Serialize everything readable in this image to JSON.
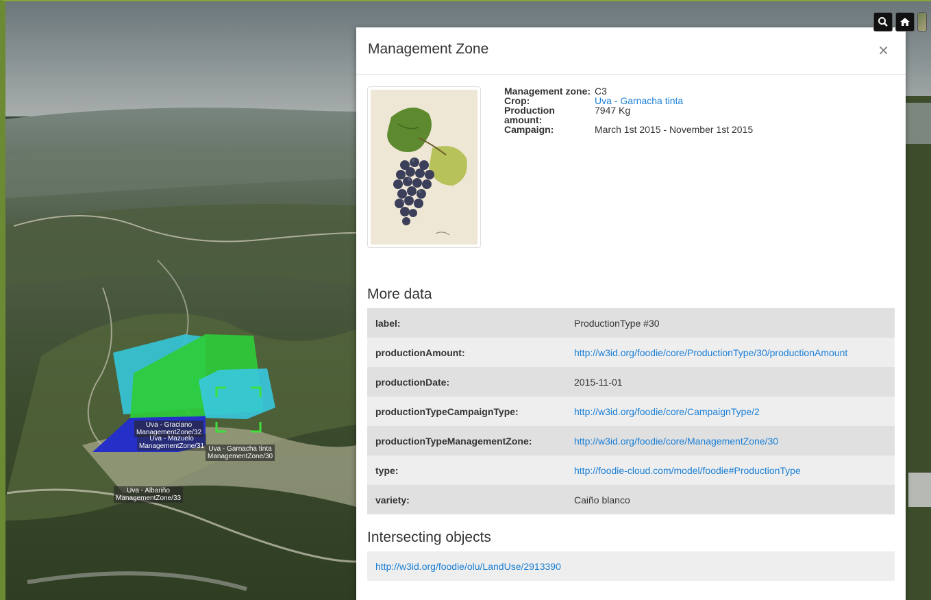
{
  "map": {
    "labels": [
      {
        "line1": "Uva - Graciano",
        "line2": "ManagementZone/32"
      },
      {
        "line1": "Uva - Mazuelo",
        "line2": "ManagementZone/31"
      },
      {
        "line1": "Uva - Garnacha tinta",
        "line2": "ManagementZone/30"
      },
      {
        "line1": "Uva - Albariño",
        "line2": "ManagementZone/33"
      }
    ],
    "toolbar": {
      "search_icon": "search-icon",
      "home_icon": "home-icon",
      "basemap_icon": "basemap-thumbnail"
    }
  },
  "modal": {
    "title": "Management Zone",
    "close_label": "×",
    "info": {
      "zone_label": "Management zone:",
      "zone_value": "C3",
      "crop_label": "Crop:",
      "crop_value": "Uva - Garnacha tinta",
      "production_label": "Production amount:",
      "production_value": "7947 Kg",
      "campaign_label": "Campaign:",
      "campaign_value": "March 1st 2015 - November 1st 2015"
    },
    "more_data_title": "More data",
    "more_data": [
      {
        "key": "label:",
        "value": "ProductionType #30",
        "is_link": false
      },
      {
        "key": "productionAmount:",
        "value": "http://w3id.org/foodie/core/ProductionType/30/productionAmount",
        "is_link": true
      },
      {
        "key": "productionDate:",
        "value": "2015-11-01",
        "is_link": false
      },
      {
        "key": "productionTypeCampaignType:",
        "value": "http://w3id.org/foodie/core/CampaignType/2",
        "is_link": true
      },
      {
        "key": "productionTypeManagementZone:",
        "value": "http://w3id.org/foodie/core/ManagementZone/30",
        "is_link": true
      },
      {
        "key": "type:",
        "value": "http://foodie-cloud.com/model/foodie#ProductionType",
        "is_link": true
      },
      {
        "key": "variety:",
        "value": "Caiño blanco",
        "is_link": false
      }
    ],
    "intersecting_title": "Intersecting objects",
    "intersecting": [
      "http://w3id.org/foodie/olu/LandUse/2913390"
    ]
  },
  "colors": {
    "link": "#1a7fd6",
    "zone_cyan": "#35c6d6",
    "zone_green": "#2ecc3a",
    "zone_blue": "#2430c8",
    "selection": "#3ee03e"
  }
}
